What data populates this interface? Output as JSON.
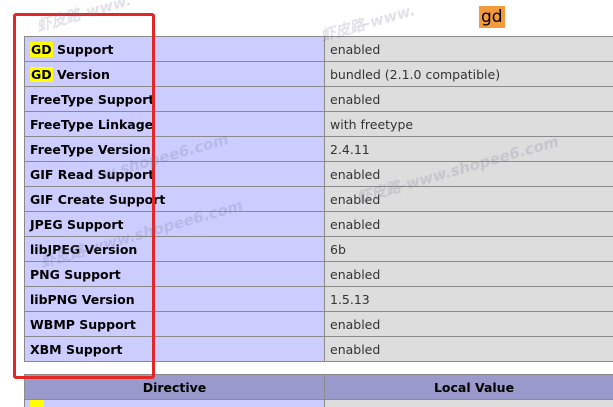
{
  "section": {
    "title": "gd"
  },
  "rows": [
    {
      "highlight": "GD",
      "label": "Support",
      "value": "enabled"
    },
    {
      "highlight": "GD",
      "label": "Version",
      "value": "bundled (2.1.0 compatible)"
    },
    {
      "highlight": "",
      "label": "FreeType Support",
      "value": "enabled"
    },
    {
      "highlight": "",
      "label": "FreeType Linkage",
      "value": "with freetype"
    },
    {
      "highlight": "",
      "label": "FreeType Version",
      "value": "2.4.11"
    },
    {
      "highlight": "",
      "label": "GIF Read Support",
      "value": "enabled"
    },
    {
      "highlight": "",
      "label": "GIF Create Support",
      "value": "enabled"
    },
    {
      "highlight": "",
      "label": "JPEG Support",
      "value": "enabled"
    },
    {
      "highlight": "",
      "label": "libJPEG Version",
      "value": "6b"
    },
    {
      "highlight": "",
      "label": "PNG Support",
      "value": "enabled"
    },
    {
      "highlight": "",
      "label": "libPNG Version",
      "value": "1.5.13"
    },
    {
      "highlight": "",
      "label": "WBMP Support",
      "value": "enabled"
    },
    {
      "highlight": "",
      "label": "XBM Support",
      "value": "enabled"
    }
  ],
  "directives": {
    "col_directive": "Directive",
    "col_local": "Local Value"
  },
  "watermarks": [
    "虾皮路-www.",
    "虾皮路-www.",
    "w.shopee6.com",
    "虾皮路-www.shopee6.com",
    "虾皮路-www.shopee6.com"
  ],
  "colors": {
    "header": "#9999cc",
    "key_cell": "#ccccff",
    "value_cell": "#dddddd",
    "highlight": "#ffff00",
    "title_bg": "#f29a3c",
    "annotation": "#e22727"
  }
}
